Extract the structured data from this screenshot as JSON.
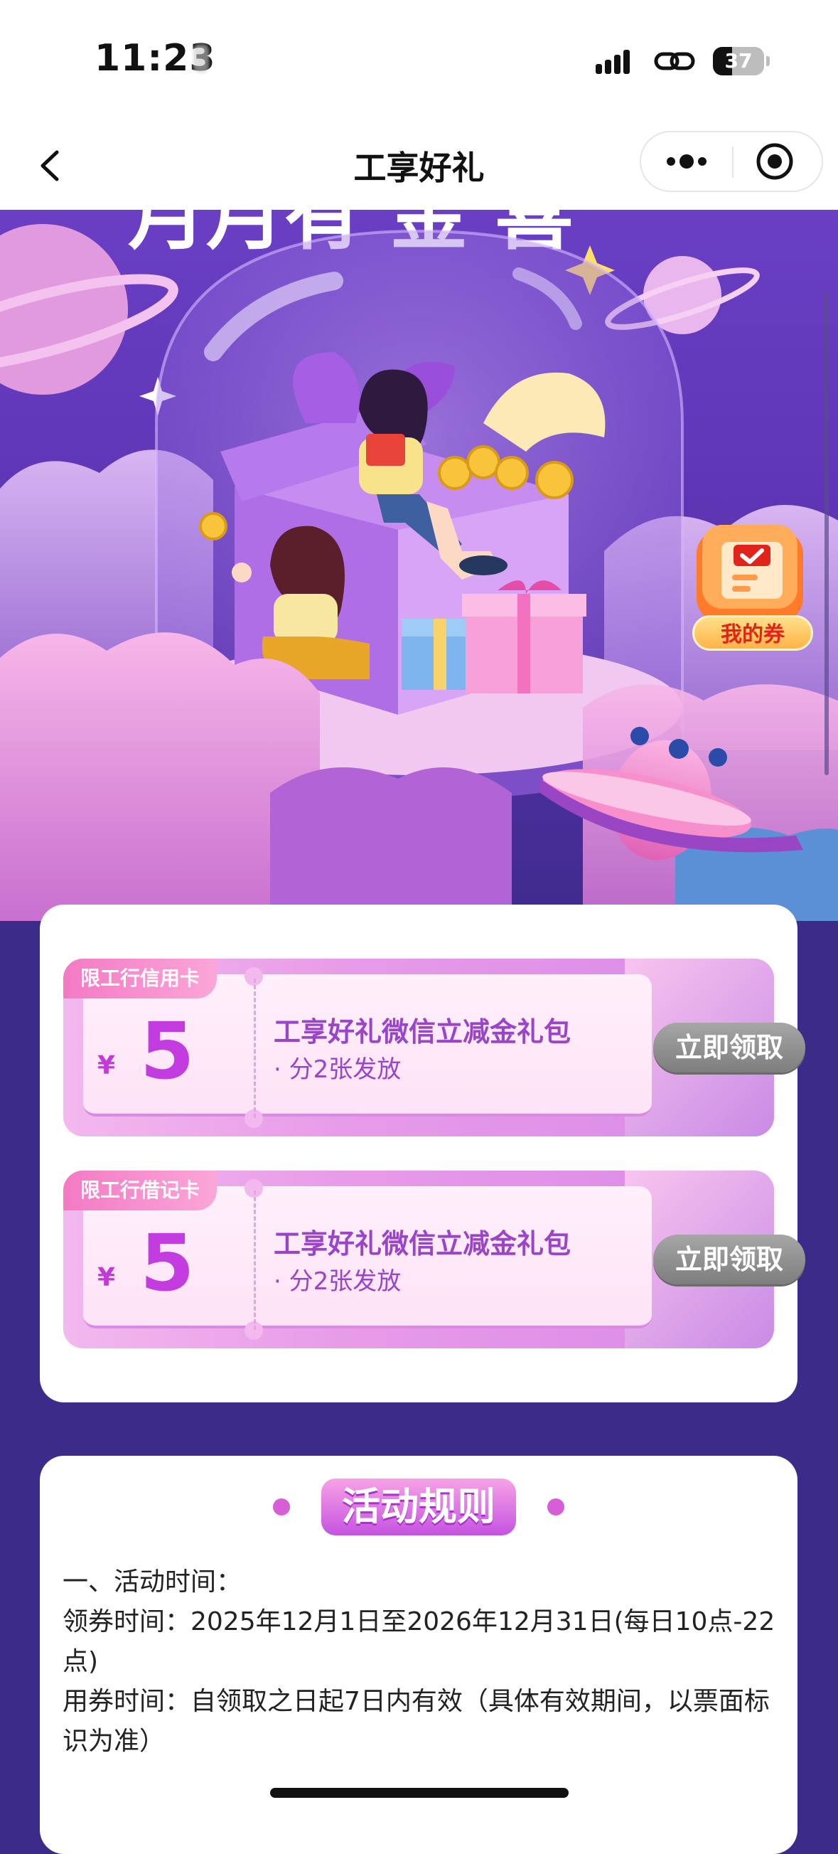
{
  "status_bar": {
    "time": "11:23",
    "battery": "37",
    "battery_level": 0.37
  },
  "nav": {
    "title": "工享好礼"
  },
  "hero": {
    "banner_text_partial": "月月有 金 喜",
    "my_coupon_label": "我的券"
  },
  "coupons": [
    {
      "tag": "限工行信用卡",
      "currency": "¥",
      "amount": "5",
      "title": "工享好礼微信立减金礼包",
      "subtitle": "· 分2张发放",
      "button": "立即领取"
    },
    {
      "tag": "限工行借记卡",
      "currency": "¥",
      "amount": "5",
      "title": "工享好礼微信立减金礼包",
      "subtitle": "· 分2张发放",
      "button": "立即领取"
    }
  ],
  "rules": {
    "title": "活动规则",
    "line1": "一、活动时间：",
    "line2": "领券时间：2025年12月1日至2026年12月31日(每日10点-22点)",
    "line3": "用券时间：自领取之日起7日内有效（具体有效期间，以票面标识为准）"
  },
  "colors": {
    "page_background": "#3d2b8a",
    "accent_purple": "#c23ce0",
    "tag_pink": "#f37ac4",
    "button_gray": "#8e8e8e",
    "my_coupon_text": "#e0241b"
  }
}
